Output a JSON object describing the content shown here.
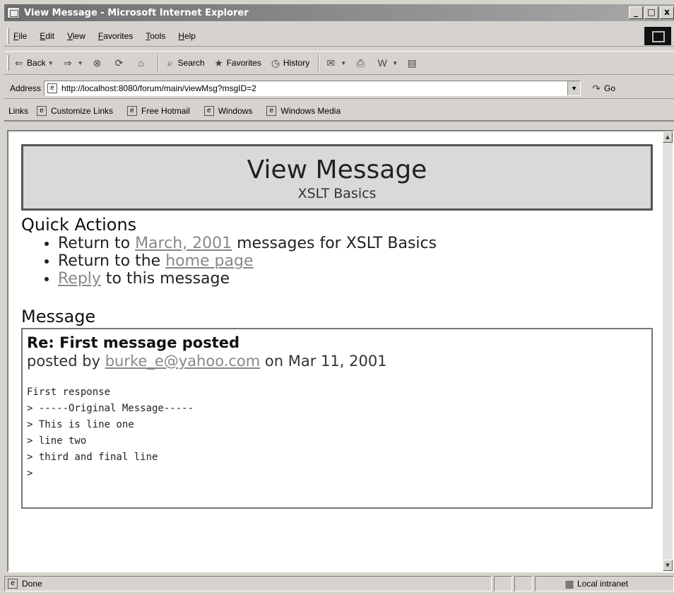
{
  "window": {
    "title": "View Message - Microsoft Internet Explorer",
    "controls": [
      "_",
      "□",
      "x"
    ]
  },
  "menu": [
    "File",
    "Edit",
    "View",
    "Favorites",
    "Tools",
    "Help"
  ],
  "toolbar": {
    "back": "Back",
    "search": "Search",
    "favorites": "Favorites",
    "history": "History"
  },
  "address": {
    "label": "Address",
    "url": "http://localhost:8080/forum/main/viewMsg?msgID=2",
    "go": "Go"
  },
  "links": {
    "label": "Links",
    "items": [
      "Customize Links",
      "Free Hotmail",
      "Windows",
      "Windows Media"
    ]
  },
  "page": {
    "title": "View Message",
    "subtitle": "XSLT Basics",
    "quick_actions_heading": "Quick Actions",
    "actions": [
      {
        "prefix": "Return to ",
        "link": "March, 2001",
        "suffix": " messages for XSLT Basics"
      },
      {
        "prefix": "Return to the ",
        "link": "home page",
        "suffix": ""
      },
      {
        "prefix": "",
        "link": "Reply",
        "suffix": " to this message"
      }
    ],
    "message_heading": "Message",
    "message": {
      "subject": "Re: First message posted",
      "posted_by_prefix": "posted by ",
      "author": "burke_e@yahoo.com",
      "date_text": " on Mar 11, 2001",
      "body": "First response\n> -----Original Message-----\n> This is line one\n> line two\n> third and final line\n>"
    }
  },
  "status": {
    "text": "Done",
    "zone": "Local intranet"
  }
}
